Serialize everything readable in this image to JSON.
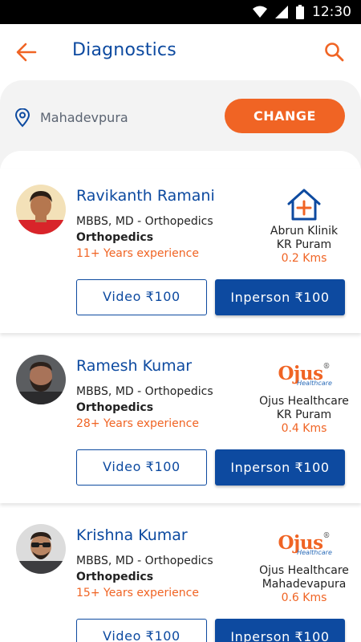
{
  "status_bar": {
    "time": "12:30"
  },
  "header": {
    "title": "Diagnostics"
  },
  "location": {
    "value": "Mahadevpura",
    "change_label": "CHANGE"
  },
  "doctors": [
    {
      "name": "Ravikanth Ramani",
      "degree": "MBBS, MD - Orthopedics",
      "specialty": "Orthopedics",
      "experience": "11+ Years experience",
      "clinic_name": "Abrun Klinik",
      "clinic_area": "KR Puram",
      "distance": "0.2 Kms",
      "clinic_logo": "house-plus-icon",
      "video_label": "Video  ₹100",
      "inperson_label": "Inperson  ₹100"
    },
    {
      "name": "Ramesh Kumar",
      "degree": "MBBS, MD - Orthopedics",
      "specialty": "Orthopedics",
      "experience": "28+ Years experience",
      "clinic_name": "Ojus Healthcare",
      "clinic_area": "KR Puram",
      "distance": "0.4 Kms",
      "clinic_logo": "ojus-logo",
      "video_label": "Video  ₹100",
      "inperson_label": "Inperson  ₹100"
    },
    {
      "name": "Krishna Kumar",
      "degree": "MBBS, MD - Orthopedics",
      "specialty": "Orthopedics",
      "experience": "15+ Years experience",
      "clinic_name": "Ojus Healthcare",
      "clinic_area": "Mahadevapura",
      "distance": "0.6 Kms",
      "clinic_logo": "ojus-logo",
      "video_label": "Video  ₹100",
      "inperson_label": "Inperson  ₹100"
    }
  ],
  "ojus_logo": {
    "main": "Ojus",
    "sub": "Healthcare",
    "reg": "®"
  },
  "colors": {
    "primary": "#0d4aa0",
    "accent": "#f06424",
    "panel": "#f3f3f3"
  }
}
